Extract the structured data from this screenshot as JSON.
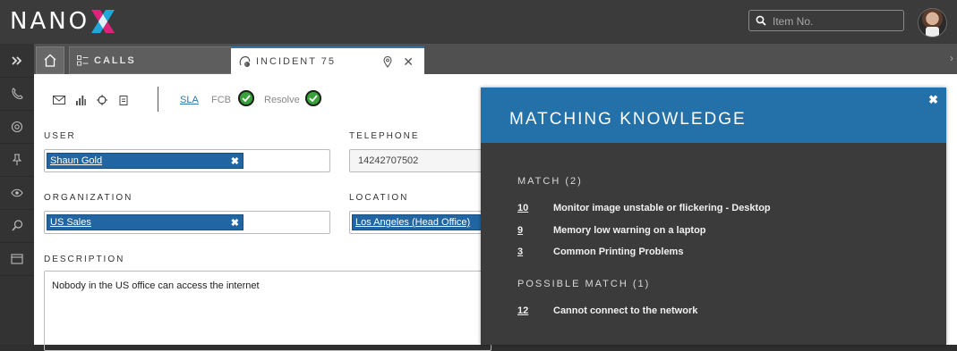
{
  "app": {
    "logo_text": "NANO"
  },
  "search": {
    "placeholder": "Item No."
  },
  "tabs": {
    "calls_label": "CALLS",
    "incident_label": "INCIDENT 75"
  },
  "toolbar": {
    "sla_label": "SLA",
    "fcb_label": "FCB",
    "resolve_label": "Resolve"
  },
  "form": {
    "user_label": "USER",
    "user_value": "Shaun Gold",
    "telephone_label": "TELEPHONE",
    "telephone_value": "14242707502",
    "organization_label": "ORGANIZATION",
    "organization_value": "US Sales",
    "location_label": "LOCATION",
    "location_value": "Los Angeles (Head Office)",
    "description_label": "DESCRIPTION",
    "description_value": "Nobody in the US office can access the internet"
  },
  "knowledge": {
    "title": "MATCHING KNOWLEDGE",
    "match_label": "MATCH (2)",
    "matches": [
      {
        "id": "10",
        "title": "Monitor image unstable or flickering - Desktop"
      },
      {
        "id": "9",
        "title": "Memory low warning on a laptop"
      },
      {
        "id": "3",
        "title": "Common Printing Problems"
      }
    ],
    "possible_label": "POSSIBLE MATCH (1)",
    "possible": [
      {
        "id": "12",
        "title": "Cannot connect to the network"
      }
    ]
  },
  "colors": {
    "accent": "#2470a8",
    "chip": "#2166a2",
    "success": "#38a13a",
    "logo_x_pink": "#e0237a",
    "logo_x_blue": "#1ea7d8"
  }
}
